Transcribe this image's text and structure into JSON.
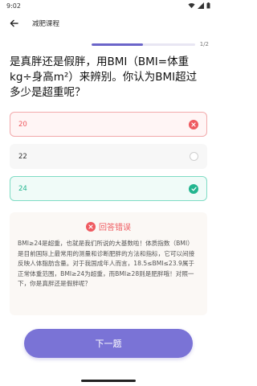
{
  "status_bar": {
    "time": "9:02"
  },
  "header": {
    "title": "减肥课程"
  },
  "progress": {
    "current_fraction": 0.5,
    "text": "1/2"
  },
  "question": {
    "text": "是真胖还是假胖，用BMI（BMI=体重kg÷身高m²）来辨别。你认为BMI超过多少是超重呢？"
  },
  "options": [
    {
      "label": "20",
      "state": "wrong"
    },
    {
      "label": "22",
      "state": "unselected"
    },
    {
      "label": "24",
      "state": "correct"
    }
  ],
  "result": {
    "title": "回答错误",
    "explanation": "BMI≥24是超重，也就是我们所说的大基数啦！体质指数（BMI）是目前国际上最常用的测量和诊断肥胖的方法和指标，它可以间接反映人体脂肪含量。对于我国成年人而言，18.5≤BMI≤23.9属于正常体重范围，BMI≥24为超重，而BMI≥28则是肥胖哦！对照一下，你是真胖还是假胖呢？"
  },
  "footer": {
    "next_label": "下一题"
  },
  "colors": {
    "accent": "#7a73d6",
    "wrong": "#ef5a60",
    "correct": "#22b58f"
  }
}
